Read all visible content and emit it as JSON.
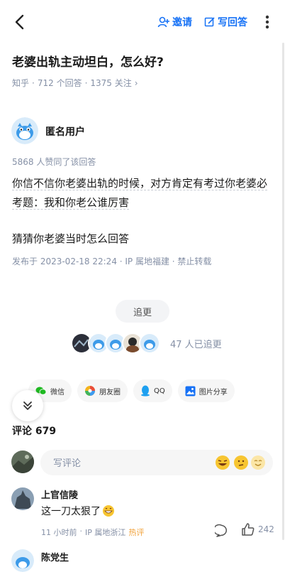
{
  "topbar": {
    "invite_label": "邀请",
    "write_label": "写回答"
  },
  "question": {
    "title": "老婆出轨主动坦白，怎么好?",
    "source": "知乎",
    "answers": "712 个回答",
    "follows": "1375 关注",
    "chevron": "›"
  },
  "answer": {
    "author": "匿名用户",
    "upvote_text": "5868 人赞同了该回答",
    "paragraph1": "你信不信你老婆出轨的时候，对方肯定有考过你老婆必考题：我和你老公谁厉害",
    "paragraph2": "猜猜你老婆当时怎么回答",
    "publish_info": "发布于 2023-02-18 22:24 · IP 属地福建 · 禁止转载"
  },
  "follow": {
    "button_label": "追更",
    "followers_text": "47 人已追更"
  },
  "share": [
    {
      "label": "微信",
      "icon": "wechat-icon"
    },
    {
      "label": "朋友圈",
      "icon": "moments-icon"
    },
    {
      "label": "QQ",
      "icon": "qq-icon"
    },
    {
      "label": "图片分享",
      "icon": "image-share-icon"
    }
  ],
  "comments": {
    "title": "评论 679",
    "input_placeholder": "写评论",
    "items": [
      {
        "name": "上官信陵",
        "text": "这一刀太狠了",
        "time": "11 小时前",
        "ip": "IP 属地浙江",
        "badge": "热评",
        "likes": "242"
      },
      {
        "name": "陈党生"
      }
    ]
  },
  "colors": {
    "accent": "#1772f6",
    "meta_gray": "#8590a6",
    "hot_badge": "#f1a23b"
  }
}
